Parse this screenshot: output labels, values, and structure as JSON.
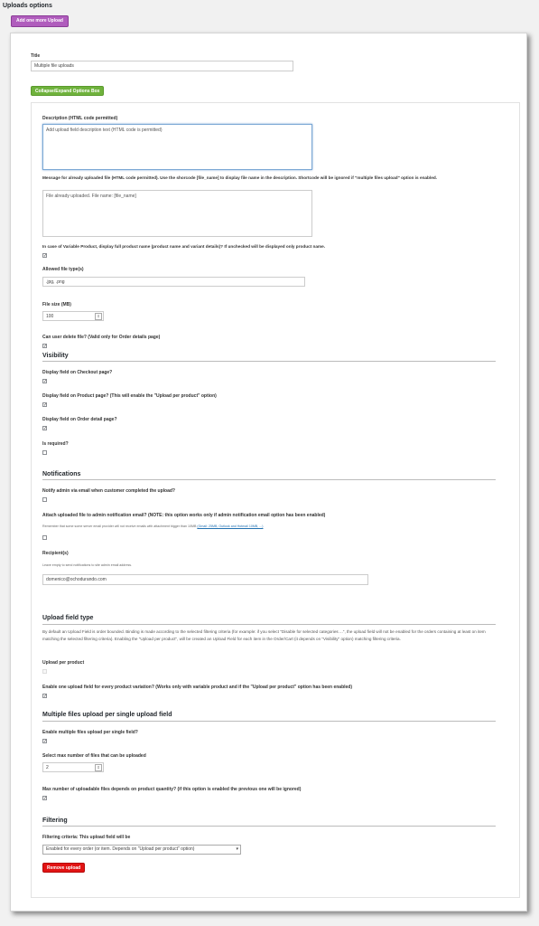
{
  "page": {
    "title": "Uploads options",
    "add_button": "Add one more Upload"
  },
  "form": {
    "title_label": "Title",
    "title_value": "Multiple file uploads",
    "collapse_button": "Collapse/Expand Options Box",
    "description_label": "Description (HTML code permitted)",
    "description_placeholder": "Add upload field description text (HTML code is permitted)",
    "already_uploaded_label": "Message for already uploaded file (HTML code permitted). Use the shorcode [file_name] to display file name in the description. Shortcode will be ignored if \"multiple files upload\" option is enabled.",
    "already_uploaded_value": "File already uploaded. File name: [file_name]",
    "variable_product_label": "In case of Variable Product, display full product name (product name and variant details)? If unchecked will be displayed only product name.",
    "variable_product_checked": true,
    "allowed_types_label": "Allowed file type(s)",
    "allowed_types_value": ".jpg, .png",
    "file_size_label": "File size (MB)",
    "file_size_value": "100",
    "can_delete_label": "Can user delete file? (Valid only for Order details page)",
    "can_delete_checked": true
  },
  "visibility": {
    "heading": "Visibility",
    "checkout_label": "Display field on Checkout page?",
    "checkout_checked": true,
    "product_label": "Display field on Product page? (This will enable the \"Upload per product\" option)",
    "product_checked": true,
    "order_label": "Display field on Order detail page?",
    "order_checked": true,
    "required_label": "Is required?",
    "required_checked": false
  },
  "notifications": {
    "heading": "Notifications",
    "notify_label": "Notify admin via email when customer completed the upload?",
    "notify_checked": false,
    "attach_label": "Attach uploaded file to admin notification email? (NOTE: this option works only if admin notification email option has been enabled)",
    "attach_note": "Remember that some some server email provider will not receive emails with attachment bigger than 10MB",
    "attach_note_link": "(Gmail: 25MB, Outlook and Hotmail 10MB, ...)",
    "attach_checked": false,
    "recipients_label": "Recipient(s)",
    "recipients_hint": "Leave empty to send notifications to site admin email address.",
    "recipients_value": "domenico@ochodurando.com"
  },
  "upload_type": {
    "heading": "Upload field type",
    "description": "By default an Upload Field is order bounded. Binding is made according to the selected filtering criteria (for example: if you select \"Disable for selected categories ...\", the upload field will not be enabled for the orders containing at least on item matching the selected filtering criteria). Enabling the \"Upload per product\", will be created an Upload Field for each item in the Order/Cart (it depends on \"Visibility\" option) matching filtering criteria.",
    "per_product_label": "Upload per product",
    "per_product_checked": false,
    "per_variation_label": "Enable one upload field for every product variation? (Works only with variable product and if the \"Upload per product\" option has been enabled)",
    "per_variation_checked": true
  },
  "multiple": {
    "heading": "Multiple files upload per single upload field",
    "enable_label": "Enable multiple files upload per single field?",
    "enable_checked": true,
    "max_label": "Select max number of files that can be uploaded",
    "max_value": "2",
    "depends_label": "Max number of uploadable files depends on product quantity? (if this option is enabled the previous one will be ignored)",
    "depends_checked": true
  },
  "filtering": {
    "heading": "Filtering",
    "criteria_label": "Filtering criteria: This upload field will be",
    "criteria_value": "Enabled for every order (or item. Depends on \"Upload per product\" option)",
    "remove_button": "Remove upload"
  },
  "icons": {
    "check": "✓",
    "spinner": "⇕",
    "select_arrow": "▾"
  }
}
